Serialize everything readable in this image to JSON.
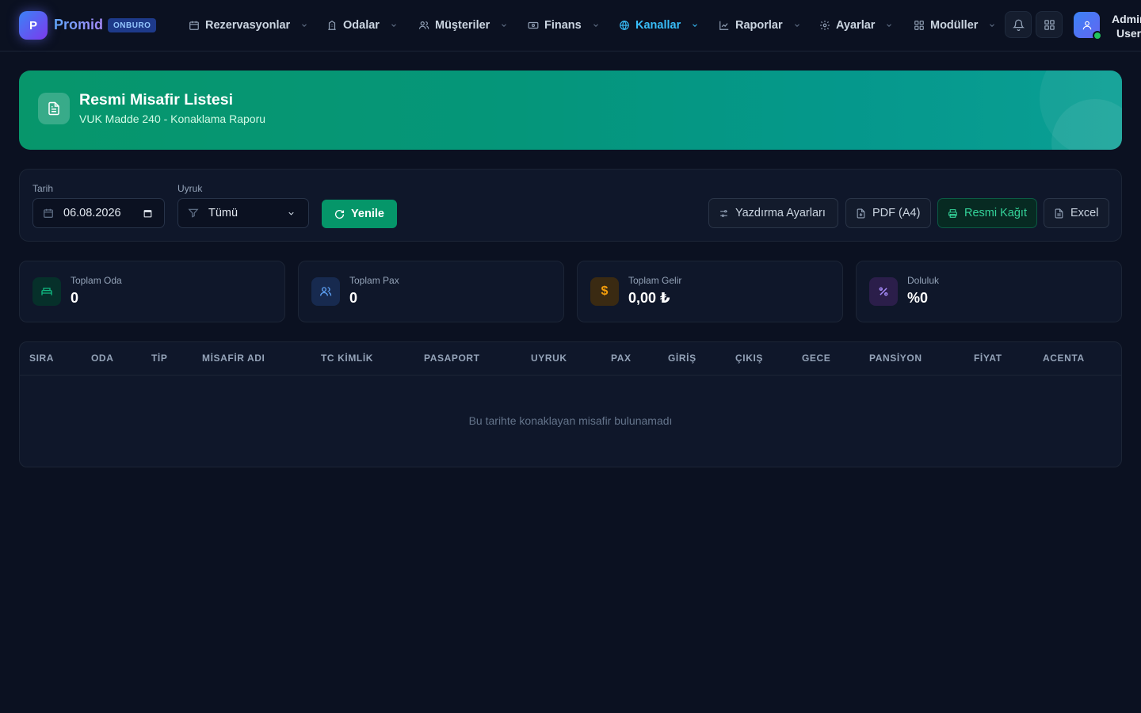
{
  "brand": {
    "initial": "P",
    "name": "Promid",
    "badge": "ONBURO"
  },
  "nav": [
    {
      "label": "Rezervasyonlar",
      "icon": "calendar-icon"
    },
    {
      "label": "Odalar",
      "icon": "building-icon"
    },
    {
      "label": "Müşteriler",
      "icon": "users-icon"
    },
    {
      "label": "Finans",
      "icon": "banknote-icon"
    },
    {
      "label": "Kanallar",
      "icon": "globe-icon",
      "active": true
    },
    {
      "label": "Raporlar",
      "icon": "chart-icon"
    },
    {
      "label": "Ayarlar",
      "icon": "gear-icon"
    },
    {
      "label": "Modüller",
      "icon": "grid-icon"
    }
  ],
  "user": {
    "name": "Admin",
    "role": "User"
  },
  "hero": {
    "title": "Resmi Misafir Listesi",
    "subtitle": "VUK Madde 240 - Konaklama Raporu"
  },
  "filters": {
    "date_label": "Tarih",
    "date_value": "06.08.2026",
    "nationality_label": "Uyruk",
    "nationality_value": "Tümü",
    "refresh_label": "Yenile"
  },
  "actions": {
    "print_settings": "Yazdırma Ayarları",
    "pdf": "PDF (A4)",
    "official_paper": "Resmi Kağıt",
    "excel": "Excel"
  },
  "stats": [
    {
      "label": "Toplam Oda",
      "value": "0",
      "icon": "bed-icon",
      "color": "#10b981"
    },
    {
      "label": "Toplam Pax",
      "value": "0",
      "icon": "users-icon",
      "color": "#60a5fa"
    },
    {
      "label": "Toplam Gelir",
      "value": "0,00 ₺",
      "icon": "dollar-icon",
      "color": "#f59e0b"
    },
    {
      "label": "Doluluk",
      "value": "%0",
      "icon": "percent-icon",
      "color": "#a78bfa"
    }
  ],
  "table": {
    "columns": [
      "SIRA",
      "ODA",
      "TİP",
      "MİSAFİR ADI",
      "TC KİMLİK",
      "PASAPORT",
      "UYRUK",
      "PAX",
      "GİRİŞ",
      "ÇIKIŞ",
      "GECE",
      "PANSİYON",
      "FİYAT",
      "ACENTA"
    ],
    "empty_message": "Bu tarihte konaklayan misafir bulunamadı"
  },
  "colors": {
    "background": "#0b1121",
    "accent_green": "#059669",
    "accent_cyan": "#38bdf8"
  }
}
